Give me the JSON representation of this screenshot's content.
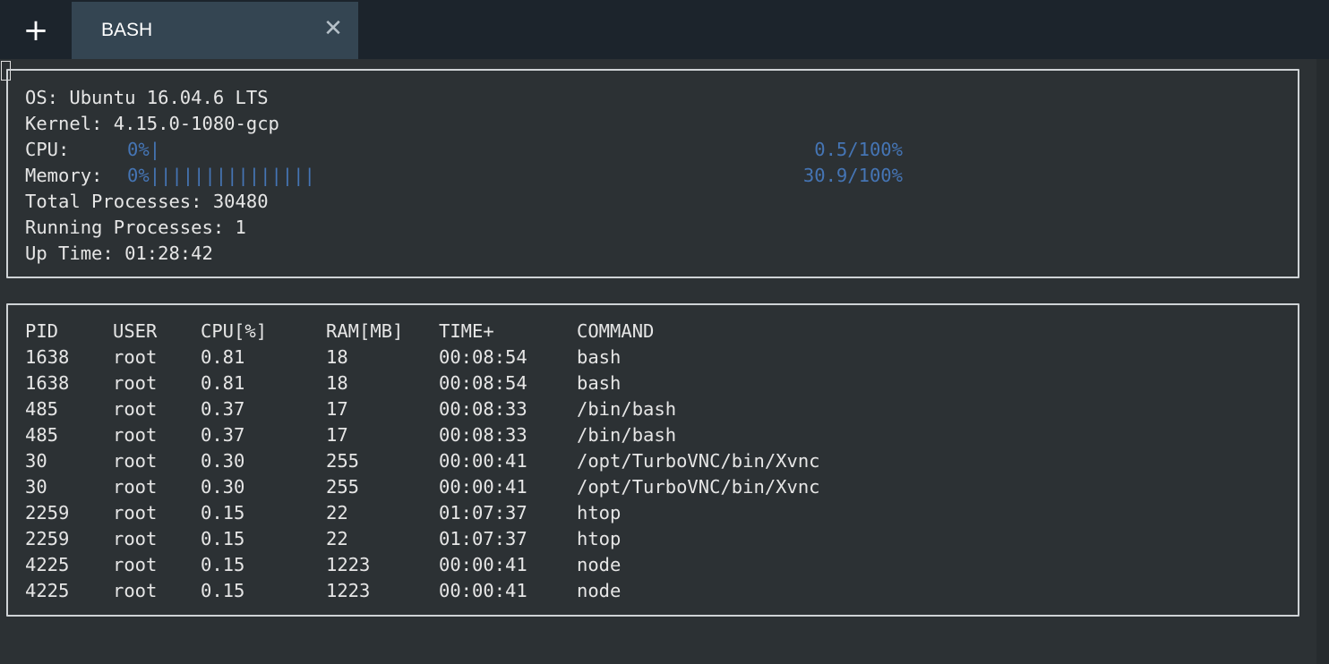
{
  "tabbar": {
    "new_tab_symbol": "+",
    "tab_label": "BASH",
    "close_symbol": "✕"
  },
  "system": {
    "os_label": "OS:",
    "os_value": "Ubuntu 16.04.6 LTS",
    "kernel_label": "Kernel:",
    "kernel_value": "4.15.0-1080-gcp",
    "cpu_label": "CPU:",
    "cpu_bar_prefix": "0%",
    "cpu_value": "0.5/100%",
    "cpu_fraction": 0.005,
    "memory_label": "Memory:",
    "memory_bar_prefix": "0%",
    "memory_value": "30.9/100%",
    "memory_fraction": 0.309,
    "total_processes_label": "Total Processes:",
    "total_processes_value": "30480",
    "running_processes_label": "Running Processes:",
    "running_processes_value": "1",
    "uptime_label": "Up Time:",
    "uptime_value": "01:28:42"
  },
  "processes": {
    "headers": [
      "PID",
      "USER",
      "CPU[%]",
      "RAM[MB]",
      "TIME+",
      "COMMAND"
    ],
    "rows": [
      [
        "1638",
        "root",
        "0.81",
        "18",
        "00:08:54",
        "bash"
      ],
      [
        "1638",
        "root",
        "0.81",
        "18",
        "00:08:54",
        "bash"
      ],
      [
        "485",
        "root",
        "0.37",
        "17",
        "00:08:33",
        "/bin/bash"
      ],
      [
        "485",
        "root",
        "0.37",
        "17",
        "00:08:33",
        "/bin/bash"
      ],
      [
        "30",
        "root",
        "0.30",
        "255",
        "00:00:41",
        "/opt/TurboVNC/bin/Xvnc"
      ],
      [
        "30",
        "root",
        "0.30",
        "255",
        "00:00:41",
        "/opt/TurboVNC/bin/Xvnc"
      ],
      [
        "2259",
        "root",
        "0.15",
        "22",
        "01:07:37",
        "htop"
      ],
      [
        "2259",
        "root",
        "0.15",
        "22",
        "01:07:37",
        "htop"
      ],
      [
        "4225",
        "root",
        "0.15",
        "1223",
        "00:00:41",
        "node"
      ],
      [
        "4225",
        "root",
        "0.15",
        "1223",
        "00:00:41",
        "node"
      ]
    ]
  },
  "colors": {
    "background": "#2c3134",
    "tabbar": "#1c242c",
    "active_tab": "#344552",
    "text": "#e6e6e6",
    "bar_blue": "#4575b5",
    "header_green": "#58a520"
  }
}
